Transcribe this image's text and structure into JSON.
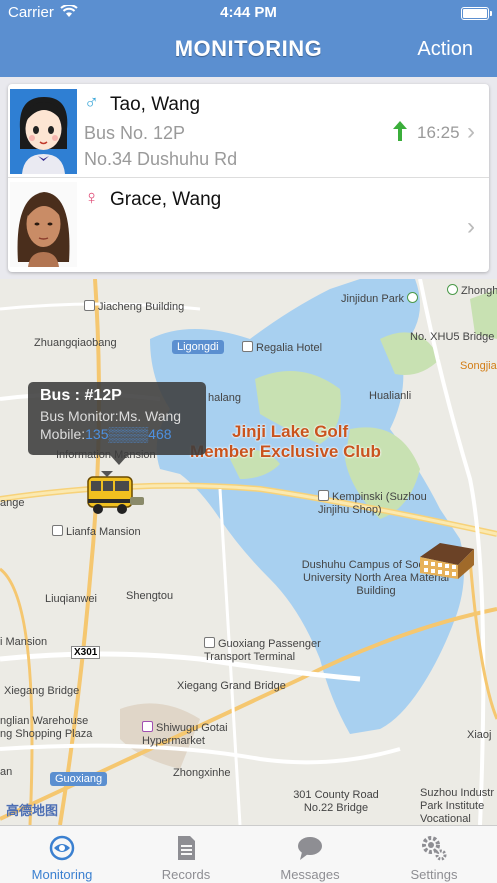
{
  "status_bar": {
    "carrier": "Carrier",
    "time": "4:44 PM"
  },
  "nav": {
    "title": "MONITORING",
    "action": "Action"
  },
  "children": [
    {
      "gender": "♂",
      "gender_color": "#3aa6d8",
      "name": "Tao, Wang",
      "bus": "Bus No. 12P",
      "location": "No.34 Dushuhu Rd",
      "time": "16:25"
    },
    {
      "gender": "♀",
      "gender_color": "#e0507a",
      "name": "Grace, Wang"
    }
  ],
  "map": {
    "callout": {
      "title": "Bus : #12P",
      "monitor": "Bus Monitor:Ms. Wang",
      "mobile_label": "Mobile:",
      "mobile": "135▒▒▒▒468"
    },
    "highlight": [
      "Jinji Lake Golf",
      "Member Exclusive Club"
    ],
    "labels": {
      "jiacheng": "Jiacheng Building",
      "zhuangqiao": "Zhuangqiaobang",
      "ligongdi": "Ligongdi",
      "regalia": "Regalia Hotel",
      "jinjidun": "Jinjidun Park",
      "zhonghai": "Zhonghai",
      "xhu5": "No. XHU5 Bridge",
      "songjia": "Songjia",
      "hualianli": "Hualianli",
      "shalang": "halang",
      "information": "Information Mansion",
      "kempinski": "Kempinski (Suzhou Jinjihu Shop)",
      "ange": "ange",
      "lianfa": "Lianfa Mansion",
      "dushuhu_campus": "Dushuhu Campus of Soochow University North Area Material Building",
      "liuqianwei": "Liuqianwei",
      "shengtou": "Shengtou",
      "mansion": "i Mansion",
      "x301": "X301",
      "guoxiang_terminal": "Guoxiang Passenger Transport Terminal",
      "xiegang_grand": "Xiegang Grand Bridge",
      "xiegang": "Xiegang Bridge",
      "nglian": "nglian Warehouse ng Shopping Plaza",
      "shiwugu": "Shiwugu Gotai Hypermarket",
      "guoxiang": "Guoxiang",
      "zhongxinhe": "Zhongxinhe",
      "an": "an",
      "county_road": "301 County Road No.22 Bridge",
      "suzhou_indus": "Suzhou Industr Park Institute Vocational Technolo",
      "xiaoj": "Xiaoj"
    },
    "logo": "高德地图"
  },
  "tabs": [
    {
      "label": "Monitoring",
      "icon": "monitoring-icon",
      "active": true
    },
    {
      "label": "Records",
      "icon": "records-icon",
      "active": false
    },
    {
      "label": "Messages",
      "icon": "messages-icon",
      "active": false
    },
    {
      "label": "Settings",
      "icon": "settings-icon",
      "active": false
    }
  ]
}
